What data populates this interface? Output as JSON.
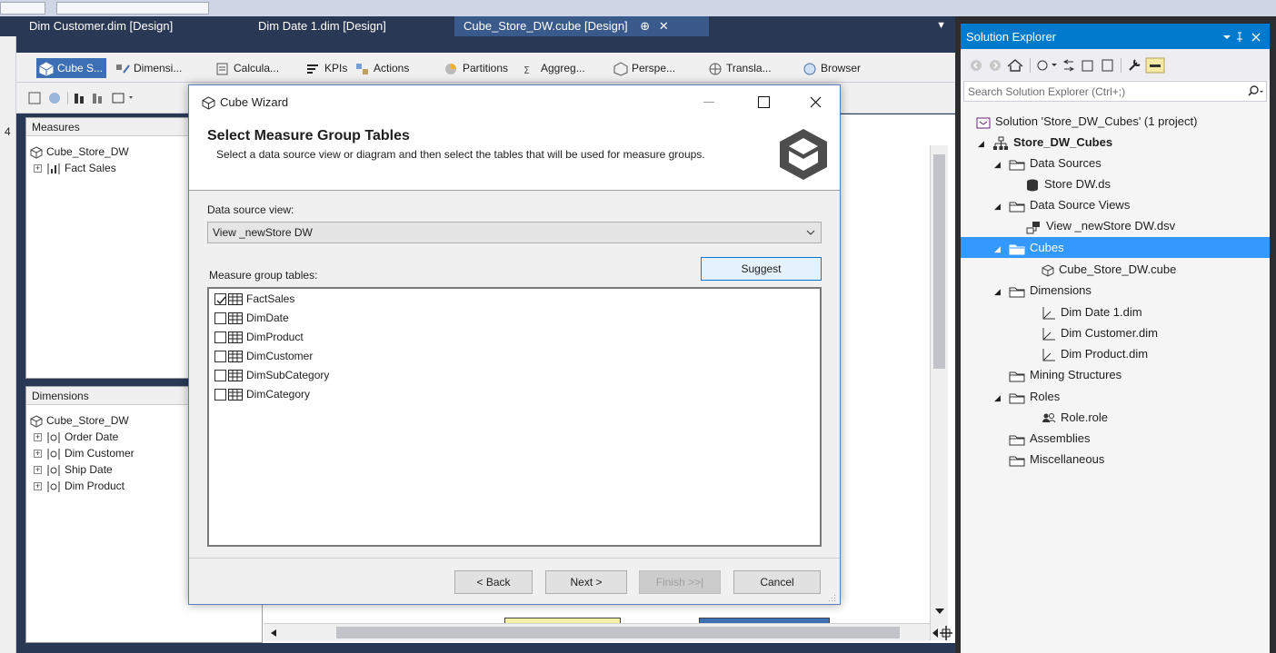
{
  "doc_tabs": [
    {
      "label": "Dim Customer.dim [Design]",
      "active": false
    },
    {
      "label": "Dim Date 1.dim [Design]",
      "active": false
    },
    {
      "label": "Cube_Store_DW.cube [Design]",
      "active": true
    }
  ],
  "active_tab_pin": "⊕",
  "active_tab_close": "✕",
  "designer_tabs": [
    "Cube S...",
    "Dimensi...",
    "Calcula...",
    "KPIs",
    "Actions",
    "Partitions",
    "Aggreg...",
    "Perspe...",
    "Transla...",
    "Browser"
  ],
  "left_gutter_digit": "4",
  "measures_pane": {
    "header": "Measures",
    "root": "Cube_Store_DW",
    "items": [
      "Fact Sales"
    ]
  },
  "dimensions_pane": {
    "header": "Dimensions",
    "root": "Cube_Store_DW",
    "items": [
      "Order Date",
      "Dim Customer",
      "Ship Date",
      "Dim Product"
    ]
  },
  "wizard": {
    "title": "Cube Wizard",
    "heading": "Select Measure Group Tables",
    "description": "Select a data source view or diagram and then select the tables that will be used for measure groups.",
    "dsv_label": "Data source view:",
    "dsv_value": "View _newStore DW",
    "mg_label": "Measure group tables:",
    "suggest_label": "Suggest",
    "tables": [
      {
        "name": "FactSales",
        "checked": true
      },
      {
        "name": "DimDate",
        "checked": false
      },
      {
        "name": "DimProduct",
        "checked": false
      },
      {
        "name": "DimCustomer",
        "checked": false
      },
      {
        "name": "DimSubCategory",
        "checked": false
      },
      {
        "name": "DimCategory",
        "checked": false
      }
    ],
    "back_label": "< Back",
    "next_label": "Next >",
    "finish_label": "Finish >>|",
    "cancel_label": "Cancel"
  },
  "solution_explorer": {
    "title": "Solution Explorer",
    "search_placeholder": "Search Solution Explorer (Ctrl+;)",
    "solution": "Solution 'Store_DW_Cubes' (1 project)",
    "project": "Store_DW_Cubes",
    "data_sources": "Data Sources",
    "store_ds": "Store DW.ds",
    "dsv_folder": "Data Source Views",
    "dsv_file": "View _newStore DW.dsv",
    "cubes": "Cubes",
    "cube_file": "Cube_Store_DW.cube",
    "dimensions": "Dimensions",
    "dim_files": [
      "Dim Date 1.dim",
      "Dim Customer.dim",
      "Dim Product.dim"
    ],
    "mining": "Mining Structures",
    "roles": "Roles",
    "role_file": "Role.role",
    "assemblies": "Assemblies",
    "misc": "Miscellaneous"
  },
  "colors": {
    "accent": "#007acc",
    "selection": "#3399ff",
    "tab_bg": "#293955"
  }
}
